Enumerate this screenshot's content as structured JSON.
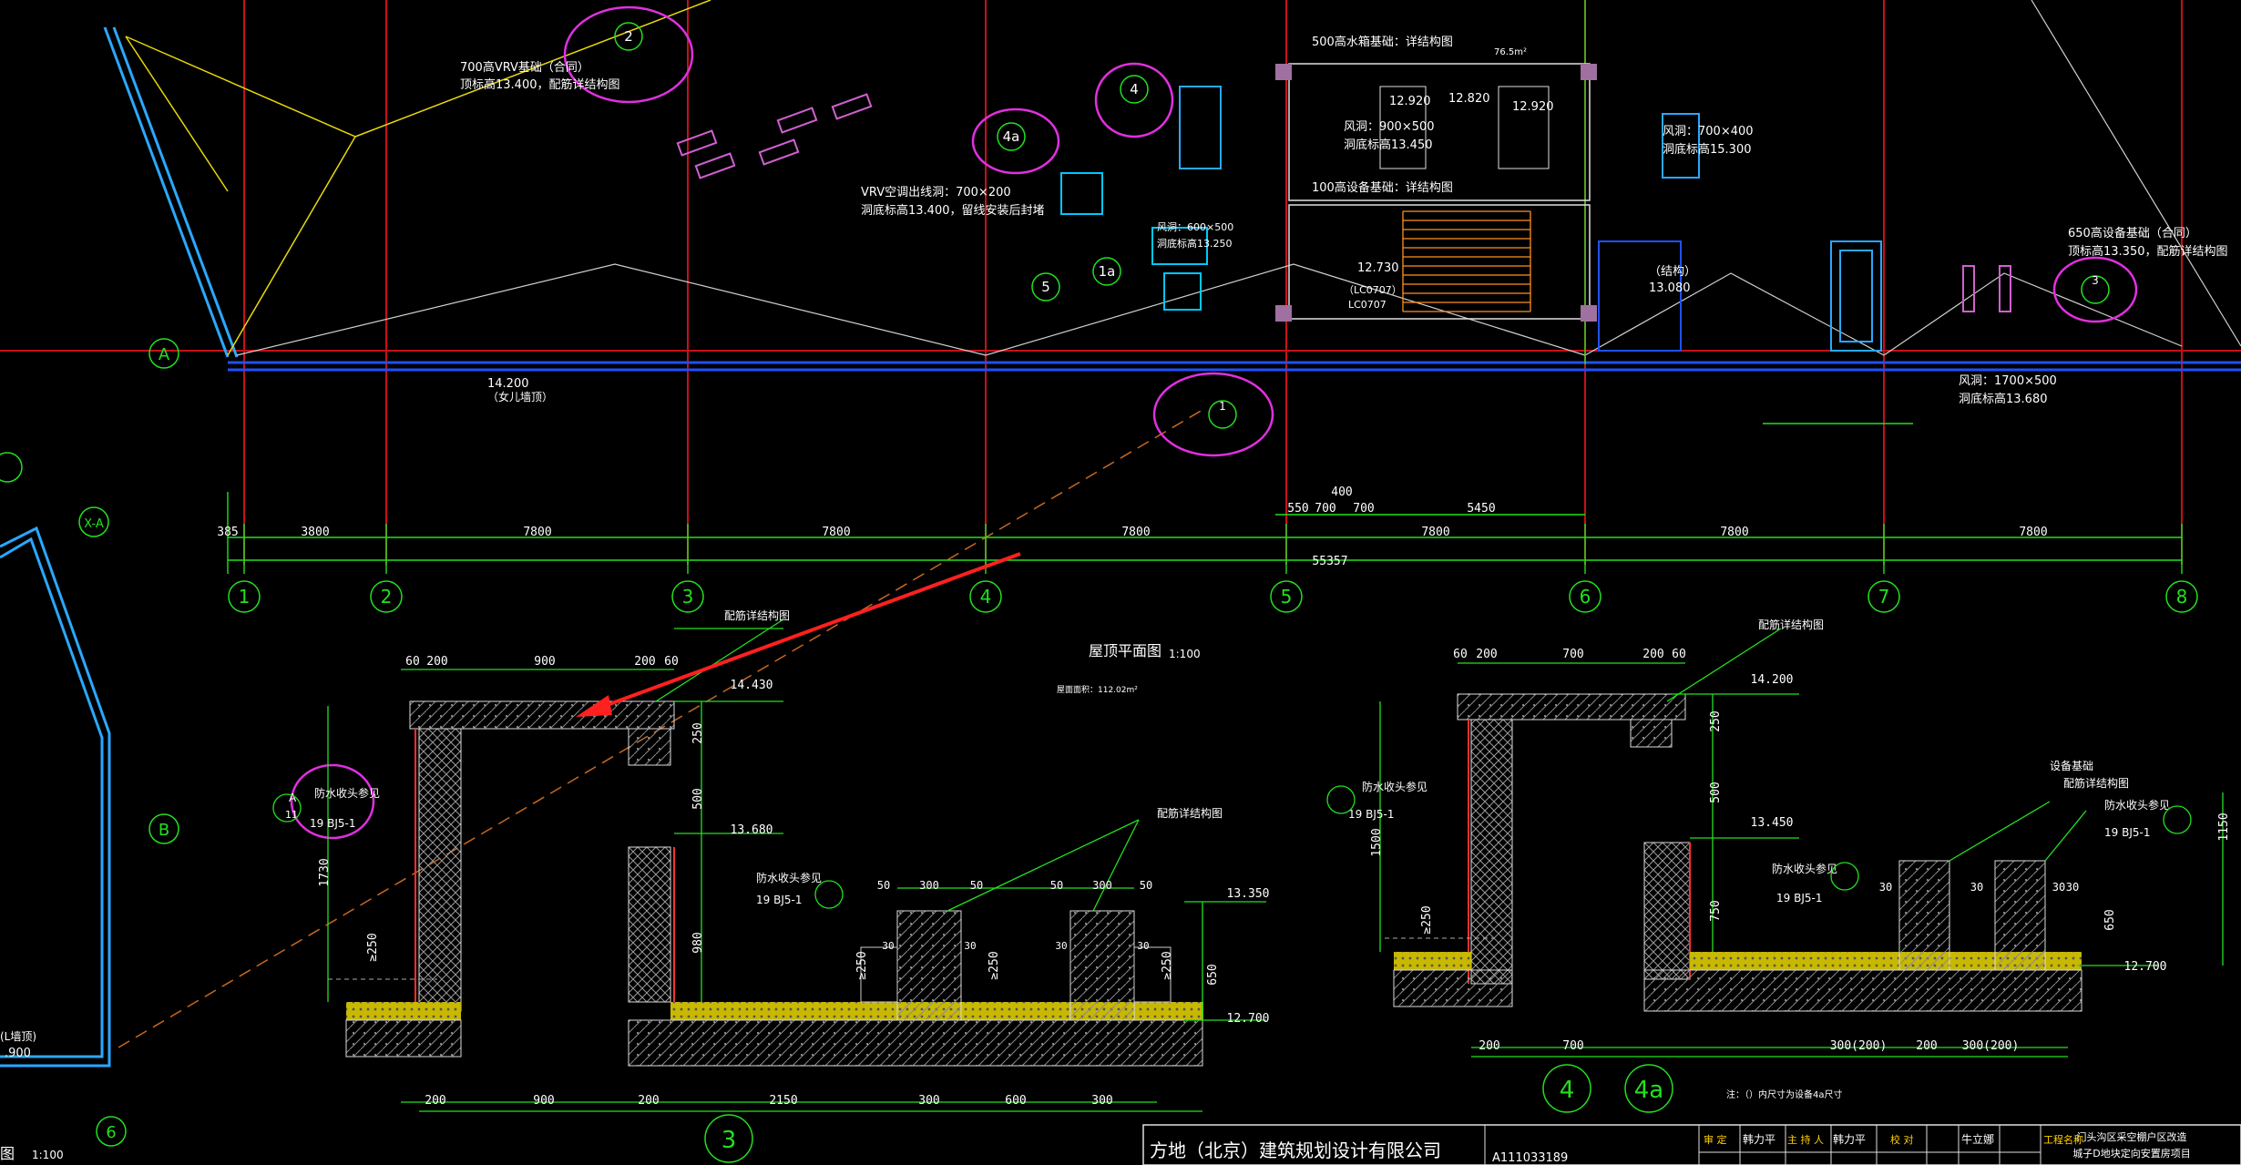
{
  "colors": {
    "background": "#000000",
    "grid_red": "#c8101a",
    "dim_green": "#23e01f",
    "wall_cyan": "#00c8ff",
    "wall_blue": "#2050ff",
    "highlight_magenta": "#e030e0",
    "annotation_white": "#ffffff",
    "roof_yellow": "#e8d80a",
    "stair_orange": "#ff9020",
    "arrow_red": "#ff2020"
  },
  "grid": {
    "axis_labels": [
      "1",
      "2",
      "3",
      "4",
      "5",
      "6",
      "7",
      "8"
    ],
    "row_labels": [
      "A",
      "B",
      "X-A",
      "6"
    ],
    "spans": [
      "385",
      "3800",
      "7800",
      "7800",
      "7800",
      "7800",
      "7800",
      "7800"
    ],
    "total_length": "55357",
    "upper_dims": [
      "400",
      "550",
      "700",
      "700",
      "5450"
    ]
  },
  "plan_labels": {
    "vrv_base_1": "700高VRV基础（合同）",
    "vrv_base_2": "顶标高13.400，配筋详结构图",
    "vrv_pipe_1": "VRV空调出线洞：700×200",
    "vrv_pipe_2": "洞底标高13.400，留线安装后封堵",
    "water_tank": "500高水箱基础：详结构图",
    "equip_base": "100高设备基础：详结构图",
    "vent_1a": "风洞：900×500",
    "vent_1b": "洞底标高13.450",
    "vent_2a": "风洞：700×400",
    "vent_2b": "洞底标高15.300",
    "vent_3a": "风洞：1700×500",
    "vent_3b": "洞底标高13.680",
    "vent_4a": "风洞：600×500",
    "vent_4b": "洞底标高13.250",
    "base_650a": "650高设备基础（合同）",
    "base_650b": "顶标高13.350，配筋详结构图",
    "parapet_level": "14.200",
    "parapet_note": "（女儿墙顶）",
    "structure": "（结构）",
    "structure_level": "13.080",
    "level_12920": "12.920",
    "level_12820": "12.820",
    "level_12920b": "12.920",
    "level_12730": "12.730",
    "lc_1": "LC0707",
    "lc_2": "（LC0707）",
    "area_1": "76.5m²",
    "roof_title": "屋顶平面图",
    "roof_scale": "1:100",
    "roof_area": "屋面面积：112.02m²",
    "left_title": "图",
    "left_scale": "1:100",
    "left_level": ".900",
    "left_wall": "(L墙顶)"
  },
  "bubbles": {
    "b2": "2",
    "b4": "4",
    "b4a": "4a",
    "b5": "5",
    "b1a": "1a",
    "b1": "1",
    "b3": "3",
    "bottom_4": "4",
    "bottom_4a": "4a",
    "section_3": "3"
  },
  "detail_left": {
    "dims_top": [
      "60",
      "200",
      "900",
      "200",
      "60"
    ],
    "dims_bottom": [
      "200",
      "900",
      "200",
      "2150",
      "300",
      "600",
      "300"
    ],
    "levels": [
      "14.430",
      "13.680",
      "13.350",
      "12.700"
    ],
    "vertical_dims": [
      "250",
      "500",
      "980",
      "1730",
      "≥250",
      "≥250",
      "≥250",
      "≥250",
      "650"
    ],
    "small_dims": [
      "50",
      "300",
      "50",
      "50",
      "300",
      "50",
      "30",
      "30",
      "30",
      "30"
    ],
    "note_rebar": "配筋详结构图",
    "note_rebar2": "配筋详结构图",
    "note_waterproof": "防水收头参见",
    "ref_a": "A",
    "ref_11": "11",
    "ref_code": "19 BJ5-1"
  },
  "detail_right": {
    "dims_top": [
      "60",
      "200",
      "700",
      "200",
      "60"
    ],
    "dims_bottom": [
      "200",
      "700",
      "300(200)",
      "200",
      "300(200)"
    ],
    "levels": [
      "14.200",
      "13.450",
      "12.700"
    ],
    "vertical_dims": [
      "250",
      "500",
      "750",
      "1500",
      "≥250",
      "1150",
      "650"
    ],
    "small_dims": [
      "30",
      "30",
      "30",
      "30"
    ],
    "note_rebar": "配筋详结构图",
    "note_equip": "设备基础",
    "note_equip2": "配筋详结构图",
    "note_waterproof": "防水收头参见",
    "ref_code": "19 BJ5-1",
    "footnote": "注：（）内尺寸为设备4a尺寸"
  },
  "title_block": {
    "company": "方地（北京）建筑规划设计有限公司",
    "drawing_no": "A111033189",
    "audit": "审 定",
    "auditor": "韩力平",
    "lead": "主 持 人",
    "lead_name": "韩力平",
    "check": "校 对",
    "checker": "牛立娜",
    "project_label": "工程名称",
    "project_1": "门头沟区采空棚户区改造",
    "project_2": "城子D地块定向安置房项目"
  }
}
